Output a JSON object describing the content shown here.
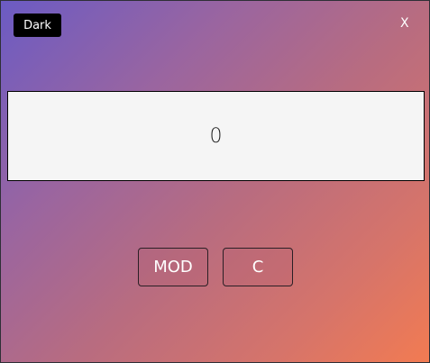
{
  "theme_toggle": {
    "label": "Dark"
  },
  "close": {
    "label": "X"
  },
  "display": {
    "value": "0"
  },
  "buttons": {
    "mod": "MOD",
    "clear": "C"
  },
  "colors": {
    "gradient_start": "#6b5bc4",
    "gradient_end": "#f27b52",
    "display_bg": "#f5f5f5"
  }
}
